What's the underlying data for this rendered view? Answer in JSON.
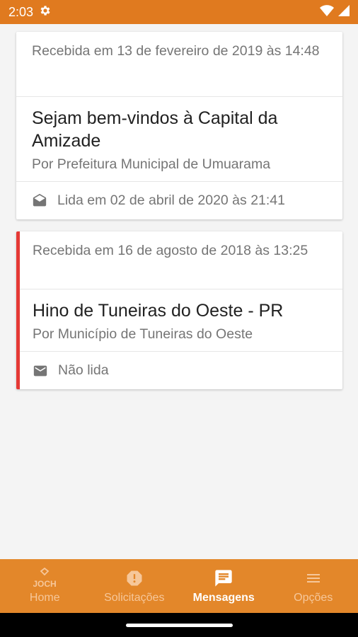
{
  "status_bar": {
    "time": "2:03"
  },
  "messages": [
    {
      "received": "Recebida em 13 de fevereiro de 2019 às 14:48",
      "title": "Sejam bem-vindos à Capital da Amizade",
      "author": "Por Prefeitura Municipal de Umuarama",
      "status": "Lida em 02 de abril de 2020 às 21:41",
      "read": true
    },
    {
      "received": "Recebida em 16 de agosto de 2018 às 13:25",
      "title": "Hino de Tuneiras do Oeste - PR",
      "author": "Por Município de Tuneiras do Oeste",
      "status": "Não lida",
      "read": false,
      "accent_color": "#e53935"
    }
  ],
  "bottom_nav": {
    "background": "#e3872a",
    "items": [
      {
        "label": "Home",
        "icon": "joch-logo-icon"
      },
      {
        "label": "Solicitações",
        "icon": "alert-octagon-icon"
      },
      {
        "label": "Mensagens",
        "icon": "message-icon",
        "active": true
      },
      {
        "label": "Opções",
        "icon": "menu-icon"
      }
    ]
  }
}
